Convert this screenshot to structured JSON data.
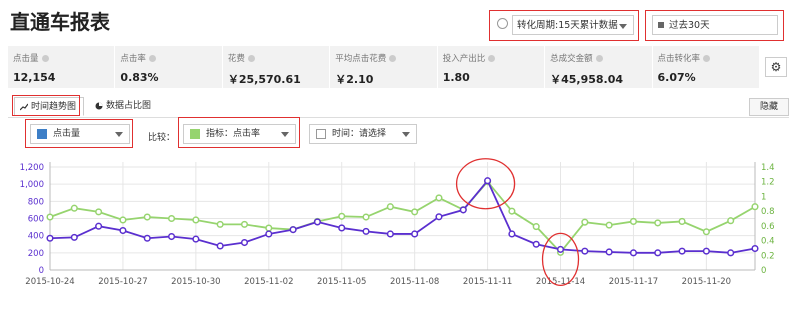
{
  "page": {
    "title": "直通车报表"
  },
  "controls": {
    "period_label": "转化周期:15天累计数据",
    "range_label": "过去30天"
  },
  "metrics": [
    {
      "label": "点击量",
      "value": "12,154"
    },
    {
      "label": "点击率",
      "value": "0.83%"
    },
    {
      "label": "花费",
      "value": "￥25,570.61"
    },
    {
      "label": "平均点击花费",
      "value": "￥2.10"
    },
    {
      "label": "投入产出比",
      "value": "1.80"
    },
    {
      "label": "总成交金额",
      "value": "￥45,958.04"
    },
    {
      "label": "点击转化率",
      "value": "6.07%"
    }
  ],
  "tabs": {
    "trend": "时间趋势图",
    "share": "数据占比图",
    "hide": "隐藏"
  },
  "filters": {
    "metric1": "点击量",
    "compare_label": "比较：",
    "metric2": "指标：点击率",
    "time": "时间：请选择"
  },
  "colors": {
    "series1": "#5a2fcf",
    "series2": "#96d46e",
    "highlight": "#e03030"
  },
  "chart_data": {
    "type": "line",
    "x": [
      "2015-10-24",
      "2015-10-25",
      "2015-10-26",
      "2015-10-27",
      "2015-10-28",
      "2015-10-29",
      "2015-10-30",
      "2015-10-31",
      "2015-11-01",
      "2015-11-02",
      "2015-11-03",
      "2015-11-04",
      "2015-11-05",
      "2015-11-06",
      "2015-11-07",
      "2015-11-08",
      "2015-11-09",
      "2015-11-10",
      "2015-11-11",
      "2015-11-12",
      "2015-11-13",
      "2015-11-14",
      "2015-11-15",
      "2015-11-16",
      "2015-11-17",
      "2015-11-18",
      "2015-11-19",
      "2015-11-20",
      "2015-11-21",
      "2015-11-22"
    ],
    "x_ticks": [
      "2015-10-24",
      "2015-10-27",
      "2015-10-30",
      "2015-11-02",
      "2015-11-05",
      "2015-11-08",
      "2015-11-11",
      "2015-11-14",
      "2015-11-17",
      "2015-11-20"
    ],
    "y_left_ticks": [
      "0",
      "200",
      "400",
      "600",
      "800",
      "1,000",
      "1,200"
    ],
    "y_right_ticks": [
      "0",
      "0.2",
      "0.4",
      "0.6",
      "0.8",
      "1",
      "1.2",
      "1.4"
    ],
    "y_left_range": [
      0,
      1200
    ],
    "y_right_range": [
      0,
      1.4
    ],
    "series": [
      {
        "axis": "left",
        "values": [
          370,
          380,
          510,
          460,
          370,
          390,
          360,
          280,
          320,
          420,
          470,
          560,
          490,
          450,
          420,
          420,
          620,
          700,
          1040,
          420,
          300,
          240,
          220,
          210,
          200,
          200,
          220,
          220,
          200,
          250
        ]
      },
      {
        "axis": "right",
        "values": [
          0.72,
          0.84,
          0.79,
          0.68,
          0.72,
          0.7,
          0.68,
          0.62,
          0.62,
          0.57,
          0.55,
          0.66,
          0.73,
          0.72,
          0.86,
          0.79,
          0.98,
          0.82,
          1.2,
          0.8,
          0.59,
          0.24,
          0.65,
          0.61,
          0.66,
          0.64,
          0.66,
          0.52,
          0.67,
          0.86
        ]
      }
    ],
    "grid": true
  }
}
